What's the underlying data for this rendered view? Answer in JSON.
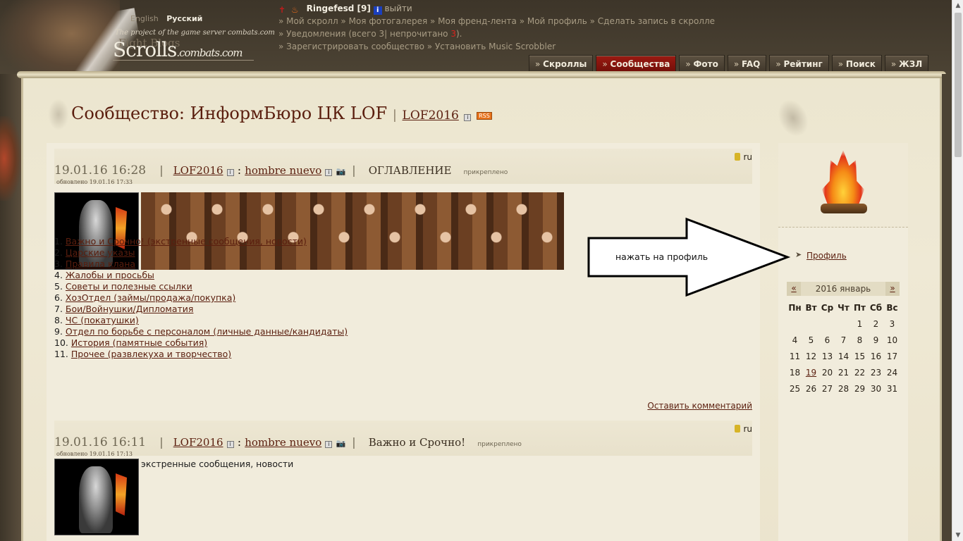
{
  "header": {
    "lang_en": "English",
    "lang_ru": "Русский",
    "tagline": "The project of the game server combats.com",
    "fight_blogs": "Fight Blogs",
    "logo_main": "Scrolls",
    "logo_sub": ".combats.com"
  },
  "userbar": {
    "username": "Ringefesd [9]",
    "logout": "выйти",
    "nav1": [
      "Мой скролл",
      "Моя фотогалерея",
      "Моя френд-лента",
      "Мой профиль",
      "Сделать запись в скролле"
    ],
    "notifications_prefix": "Уведомления (всего 3|",
    "notifications_unread_label": "непрочитано",
    "notifications_unread": "3",
    "notifications_suffix": ").",
    "nav3": [
      "Зарегистрировать сообщество",
      "Установить Music Scrobbler"
    ]
  },
  "tabs": [
    {
      "label": "Скроллы",
      "active": false
    },
    {
      "label": "Сообщества",
      "active": true
    },
    {
      "label": "Фото",
      "active": false
    },
    {
      "label": "FAQ",
      "active": false
    },
    {
      "label": "Рейтинг",
      "active": false
    },
    {
      "label": "Поиск",
      "active": false
    },
    {
      "label": "ЖЗЛ",
      "active": false
    }
  ],
  "page": {
    "title": "Сообщество: ИнформБюро ЦК LOF",
    "community_link": "LOF2016",
    "rss": "RSS"
  },
  "posts": [
    {
      "lang": "ru",
      "date": "19.01.16 16:28",
      "updated": "обновлено 19.01.16 17:33",
      "community": "LOF2016",
      "user": "hombre nuevo",
      "title": "ОГЛАВЛЕНИЕ",
      "pinned": "прикреплено",
      "comment_link": "Оставить комментарий"
    },
    {
      "lang": "ru",
      "date": "19.01.16 16:11",
      "updated": "обновлено 19.01.16 17:13",
      "community": "LOF2016",
      "user": "hombre nuevo",
      "title": "Важно и Срочно!",
      "pinned": "прикреплено",
      "text": "экстренные сообщения, новости"
    }
  ],
  "toc": [
    {
      "num": "1.",
      "label": "Важно и Срочно! (экстренные сообщения, новости)"
    },
    {
      "num": "2.",
      "label": "Царские указы"
    },
    {
      "num": "3.",
      "label": "Правила клана"
    },
    {
      "num": "4.",
      "label": "Жалобы и просьбы"
    },
    {
      "num": "5.",
      "label": "Советы и полезные ссылки"
    },
    {
      "num": "6.",
      "label": "ХозОтдел (займы/продажа/покупка)"
    },
    {
      "num": "7.",
      "label": "Бои/Войнушки/Дипломатия"
    },
    {
      "num": "8.",
      "label": "ЧС (покатушки)"
    },
    {
      "num": "9.",
      "label": "Отдел по борьбе с персоналом (личные данные/кандидаты)"
    },
    {
      "num": "10.",
      "label": "История (памятные события)"
    },
    {
      "num": "11.",
      "label": "Прочее (развлекуха и творчество)"
    }
  ],
  "sidebar": {
    "profile_link": "Профиль",
    "annotation": "нажать на профиль",
    "calendar": {
      "prev": "«",
      "next": "»",
      "title": "2016 январь",
      "dow": [
        "Пн",
        "Вт",
        "Ср",
        "Чт",
        "Пт",
        "Сб",
        "Вс"
      ],
      "days": [
        "",
        "",
        "",
        "",
        "1",
        "2",
        "3",
        "4",
        "5",
        "6",
        "7",
        "8",
        "9",
        "10",
        "11",
        "12",
        "13",
        "14",
        "15",
        "16",
        "17",
        "18",
        "19",
        "20",
        "21",
        "22",
        "23",
        "24",
        "25",
        "26",
        "27",
        "28",
        "29",
        "30",
        "31"
      ],
      "linked_day": "19"
    }
  },
  "colors": {
    "accent": "#5a1e0e",
    "active_tab": "#9c1a12",
    "parchment": "#efe9d5",
    "header_bg": "#4a4032"
  },
  "icons": [
    "cross-icon",
    "fire-icon",
    "info-icon",
    "lock-icon",
    "camera-icon",
    "rss-icon",
    "flame-icon",
    "bullet-icon"
  ]
}
